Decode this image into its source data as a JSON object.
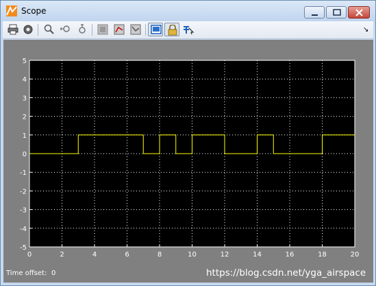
{
  "window": {
    "title": "Scope"
  },
  "toolbar": {
    "tools": [
      "print-icon",
      "parameters-icon",
      "zoom-icon",
      "zoom-x-icon",
      "zoom-y-icon",
      "autoscale-icon",
      "save-axes-icon",
      "restore-axes-icon",
      "floating-scope-icon",
      "lock-axes-icon",
      "signal-selector-icon"
    ],
    "dock_arrow": "↘"
  },
  "footer": {
    "time_offset_label": "Time offset:",
    "time_offset_value": "0",
    "watermark": "https://blog.csdn.net/yga_airspace"
  },
  "chart_data": {
    "type": "line",
    "xlim": [
      0,
      20
    ],
    "ylim": [
      -5,
      5
    ],
    "x_ticks": [
      "0",
      "2",
      "4",
      "6",
      "8",
      "10",
      "12",
      "14",
      "16",
      "18",
      "20"
    ],
    "y_ticks": [
      "5",
      "4",
      "3",
      "2",
      "1",
      "0",
      "-1",
      "-2",
      "-3",
      "-4",
      "-5"
    ],
    "grid": true,
    "background": "#000000",
    "series": [
      {
        "color": "#ffff00",
        "step": true,
        "x": [
          0,
          3,
          7,
          8,
          9,
          10,
          12,
          14,
          15,
          18,
          20
        ],
        "y": [
          0,
          1,
          0,
          1,
          0,
          1,
          0,
          1,
          0,
          1,
          1
        ]
      }
    ]
  }
}
